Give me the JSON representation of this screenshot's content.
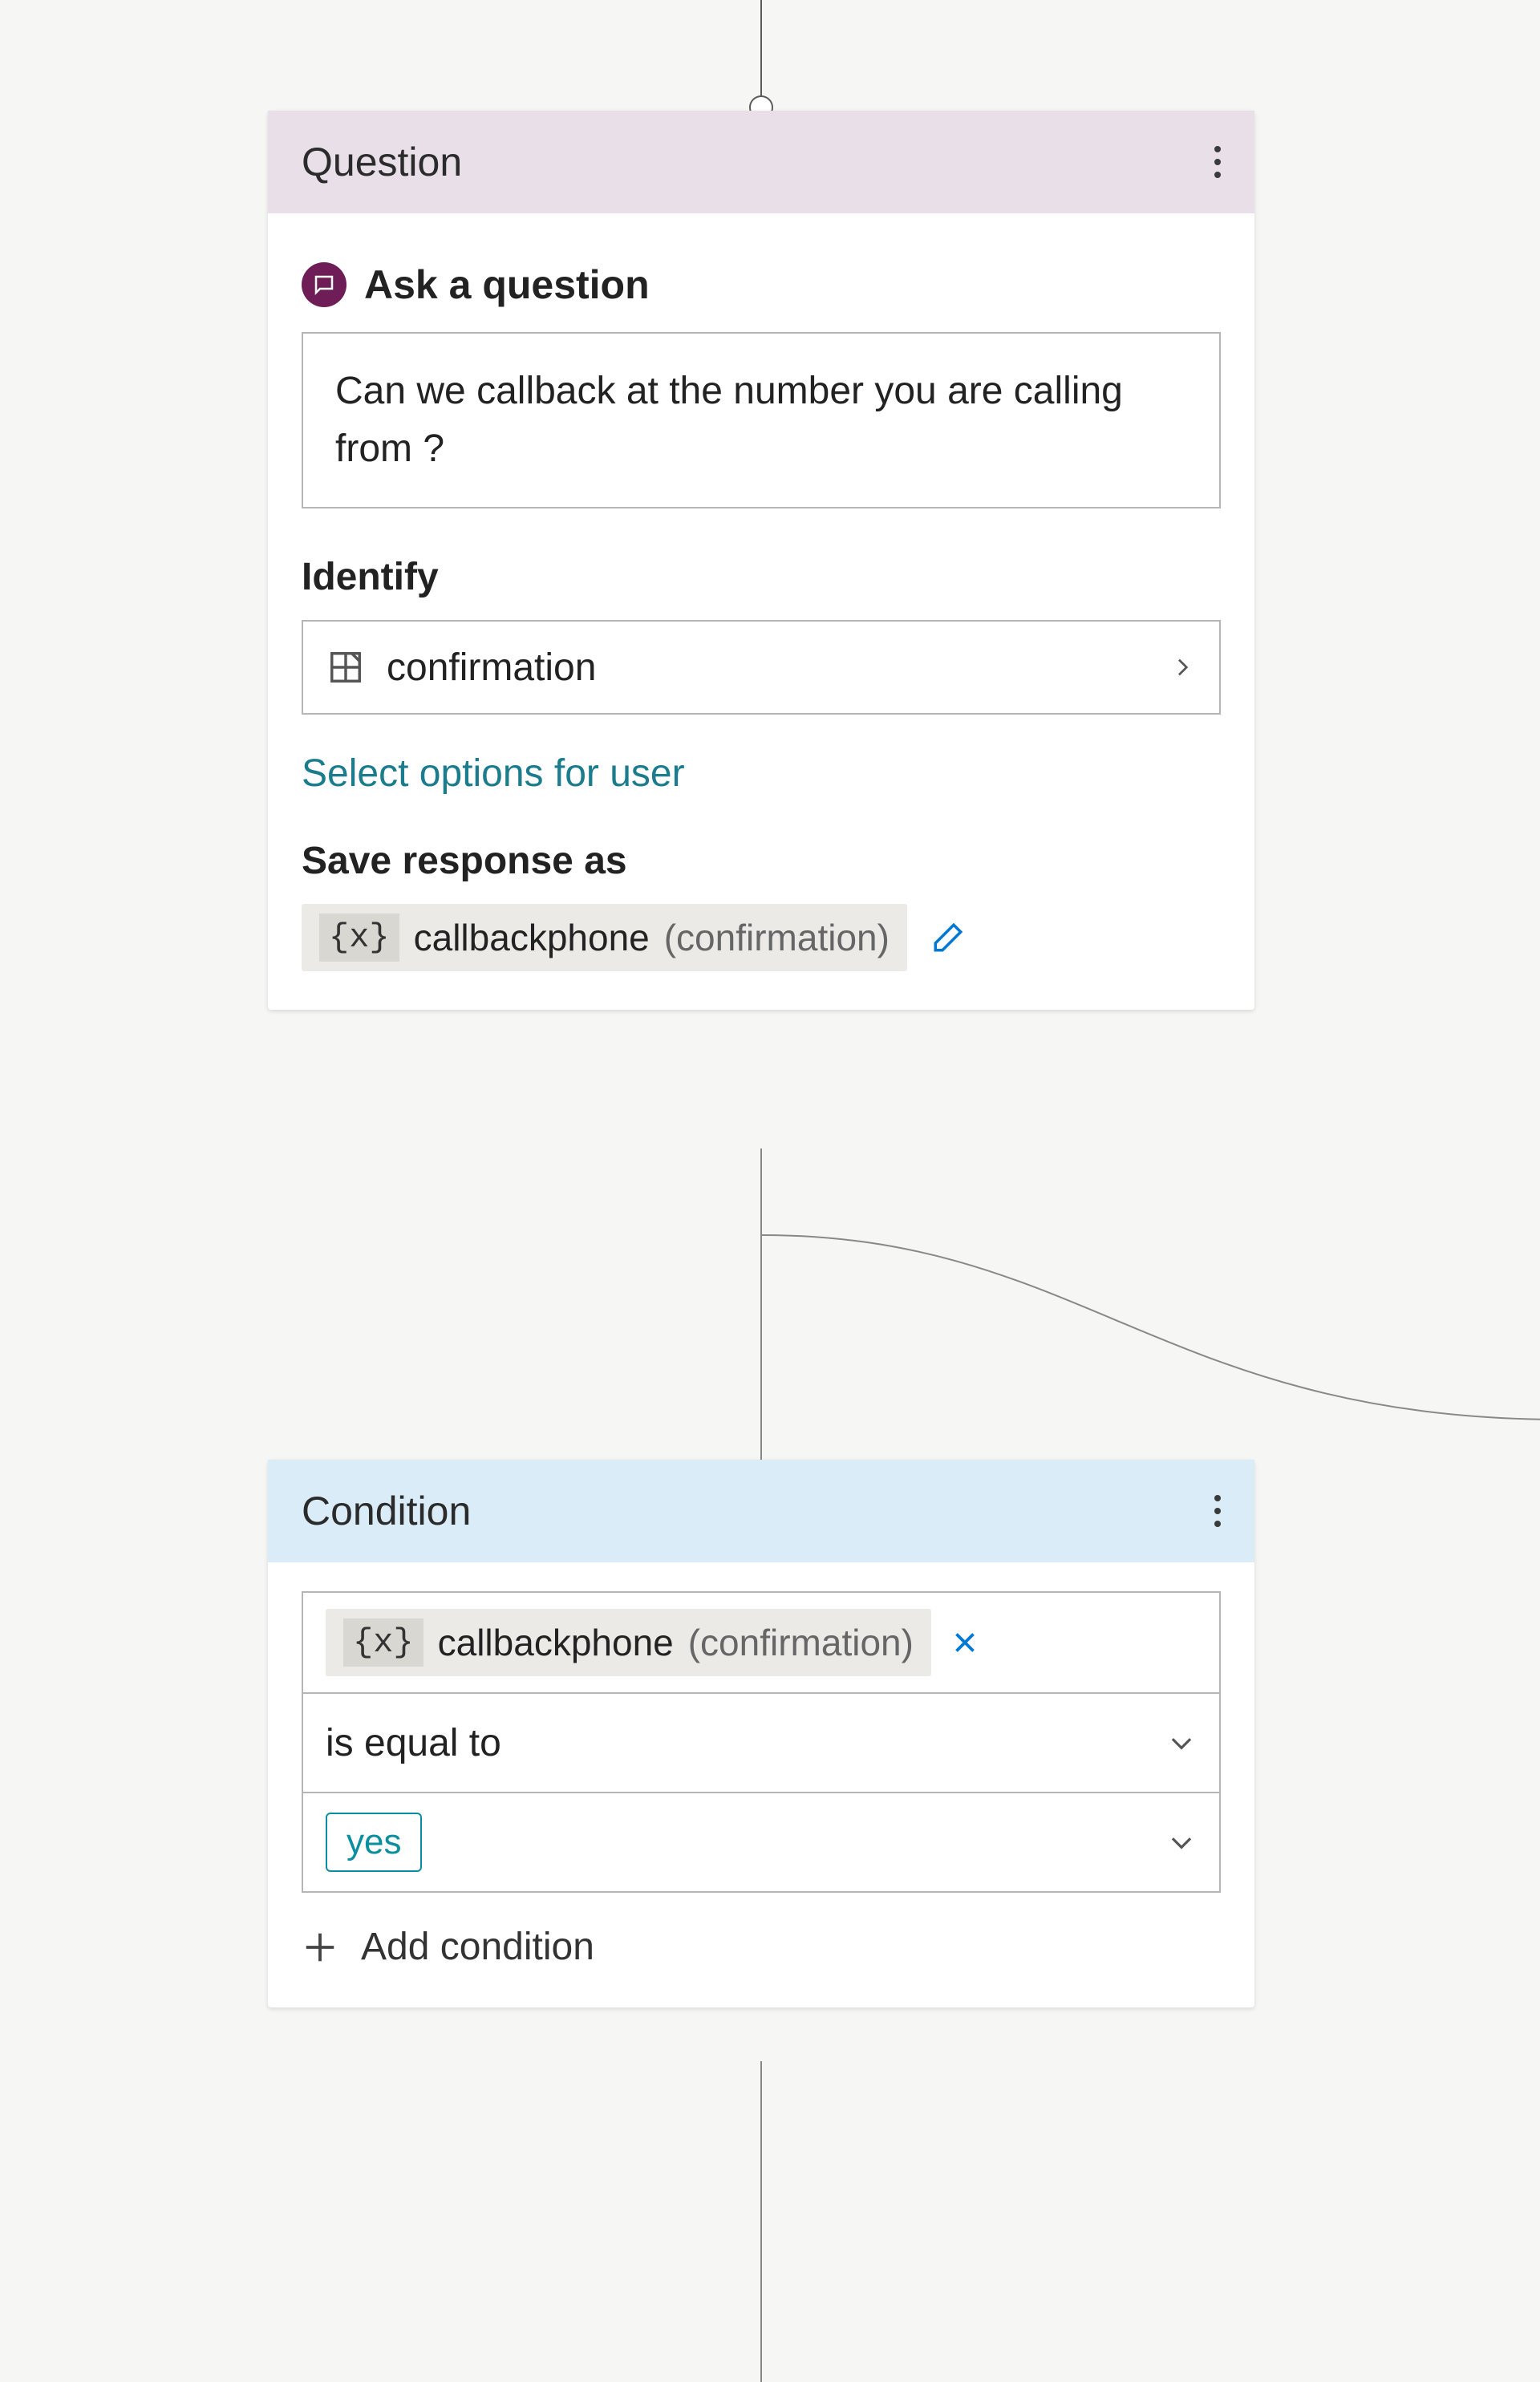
{
  "question": {
    "header": "Question",
    "ask_label": "Ask a question",
    "prompt": "Can we callback at the number you are calling from ?",
    "identify_label": "Identify",
    "identify_entity": "confirmation",
    "options_link": "Select options for user",
    "save_label": "Save response as",
    "variable": {
      "name": "callbackphone",
      "type": "(confirmation)"
    }
  },
  "condition": {
    "header": "Condition",
    "variable": {
      "name": "callbackphone",
      "type": "(confirmation)"
    },
    "operator": "is equal to",
    "value": "yes",
    "add_label": "Add condition"
  }
}
